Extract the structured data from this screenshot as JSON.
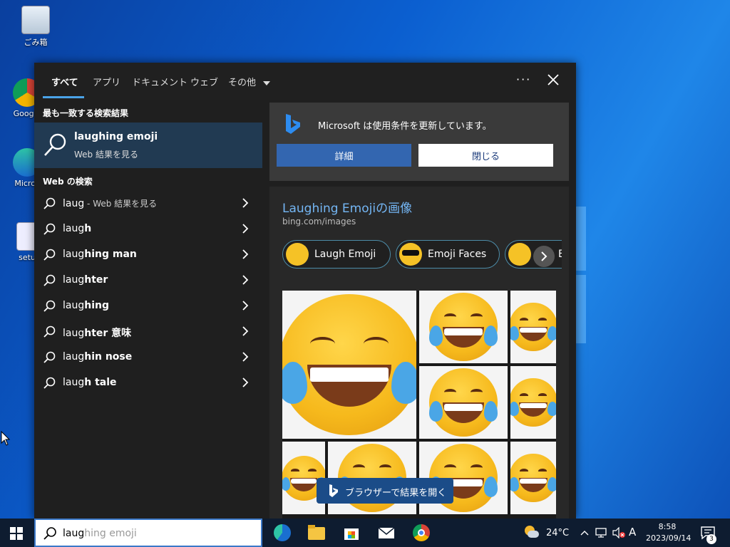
{
  "desktop": {
    "icons": [
      {
        "label": "ごみ箱"
      },
      {
        "label": "Google"
      },
      {
        "label": "Micros"
      },
      {
        "label": "setu"
      }
    ]
  },
  "panel": {
    "tabs": [
      "すべて",
      "アプリ",
      "ドキュメント",
      "ウェブ",
      "その他"
    ],
    "more_label": "···",
    "best_match": {
      "section": "最も一致する検索結果",
      "title": "laughing emoji",
      "subtitle": "Web 結果を見る"
    },
    "web_section": "Web の検索",
    "suggestions": [
      {
        "bold": "laug",
        "rest": "",
        "hint": " - Web 結果を見る"
      },
      {
        "bold": "laug",
        "rest": "h",
        "hint": ""
      },
      {
        "bold": "laug",
        "rest": "hing man",
        "hint": ""
      },
      {
        "bold": "laug",
        "rest": "hter",
        "hint": ""
      },
      {
        "bold": "laug",
        "rest": "hing",
        "hint": ""
      },
      {
        "bold": "laug",
        "rest": "hter 意味",
        "hint": ""
      },
      {
        "bold": "laug",
        "rest": "hin nose",
        "hint": ""
      },
      {
        "bold": "laug",
        "rest": "h tale",
        "hint": ""
      }
    ],
    "notice": {
      "text": "Microsoft は使用条件を更新しています。",
      "detail_button": "詳細",
      "close_button": "閉じる"
    },
    "images": {
      "title": "Laughing Emojiの画像",
      "source": "bing.com/images",
      "chips": [
        "Laugh Emoji",
        "Emoji Faces",
        "E"
      ]
    },
    "open_browser": "ブラウザーで結果を開く"
  },
  "taskbar": {
    "search_typed": "laug",
    "search_ghost": "hing emoji",
    "weather": "24°C",
    "ime": "A",
    "time": "8:58",
    "date": "2023/09/14",
    "notification_count": "3"
  },
  "colors": {
    "accent": "#4aa3e8",
    "link": "#74b6f4",
    "panel_bg": "#1f1f1f",
    "selected_bg": "#213a52"
  }
}
